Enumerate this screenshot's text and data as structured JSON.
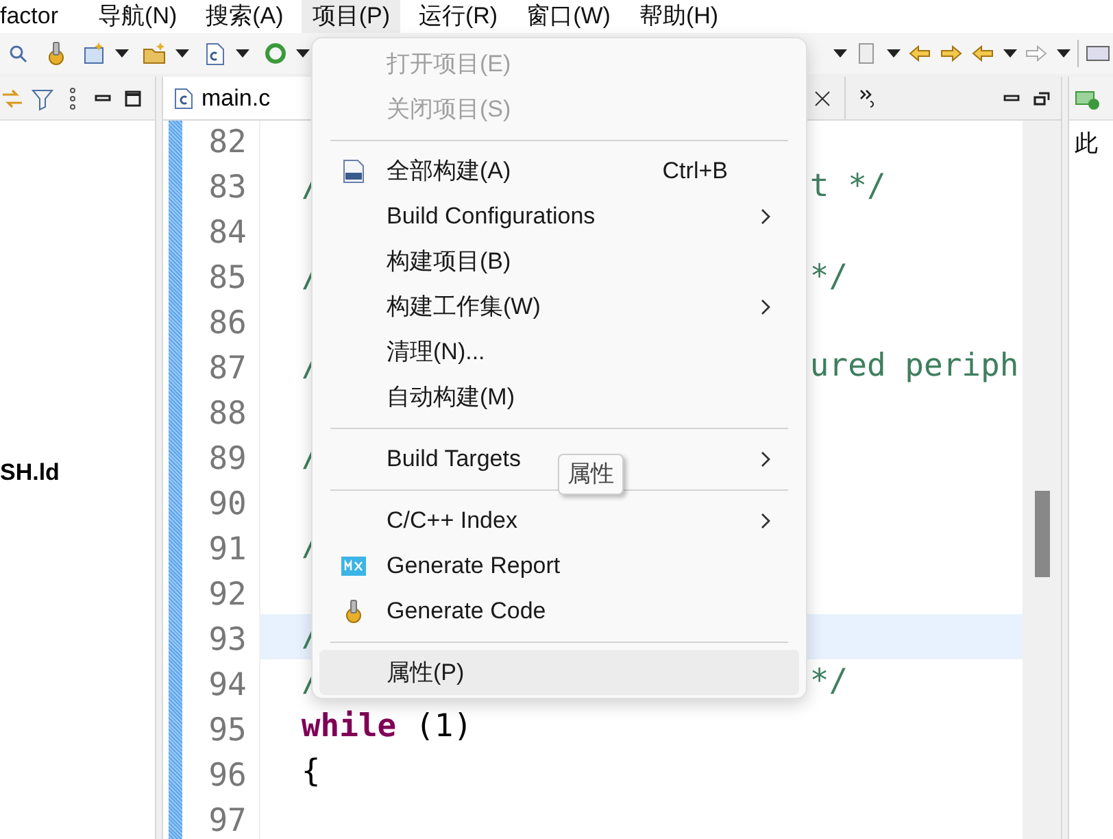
{
  "menubar": [
    {
      "label": "factor",
      "selected": false
    },
    {
      "label": "导航(N)",
      "selected": false
    },
    {
      "label": "搜索(A)",
      "selected": false
    },
    {
      "label": "项目(P)",
      "selected": true
    },
    {
      "label": "运行(R)",
      "selected": false
    },
    {
      "label": "窗口(W)",
      "selected": false
    },
    {
      "label": "帮助(H)",
      "selected": false
    }
  ],
  "left_panel": {
    "items": [
      {
        "label": "SH.ld"
      }
    ]
  },
  "editor": {
    "tab": {
      "label": "main.c"
    },
    "lines": [
      {
        "number": "82",
        "selected": false
      },
      {
        "number": "83",
        "selected": false,
        "tokens": [
          {
            "text": "/",
            "kind": "comment"
          }
        ],
        "right": {
          "text": "t */",
          "kind": "comment"
        }
      },
      {
        "number": "84",
        "selected": false
      },
      {
        "number": "85",
        "selected": false,
        "tokens": [
          {
            "text": "/",
            "kind": "comment"
          }
        ],
        "right": {
          "text": "*/",
          "kind": "comment"
        }
      },
      {
        "number": "86",
        "selected": false
      },
      {
        "number": "87",
        "selected": false,
        "tokens": [
          {
            "text": "/",
            "kind": "comment"
          }
        ],
        "right": {
          "text": "ured periph",
          "kind": "comment"
        }
      },
      {
        "number": "88",
        "selected": false
      },
      {
        "number": "89",
        "selected": false,
        "tokens": [
          {
            "text": "/",
            "kind": "comment"
          }
        ]
      },
      {
        "number": "90",
        "selected": false
      },
      {
        "number": "91",
        "selected": false,
        "tokens": [
          {
            "text": "/",
            "kind": "comment"
          }
        ]
      },
      {
        "number": "92",
        "selected": false
      },
      {
        "number": "93",
        "selected": true,
        "tokens": [
          {
            "text": "/",
            "kind": "comment"
          }
        ]
      },
      {
        "number": "94",
        "selected": false,
        "tokens": [
          {
            "text": "/",
            "kind": "comment"
          }
        ],
        "right": {
          "text": "*/",
          "kind": "comment"
        }
      },
      {
        "number": "95",
        "selected": false,
        "tokens": [
          {
            "text": "while",
            "kind": "keyword"
          },
          {
            "text": " (1)",
            "kind": "plain"
          }
        ]
      },
      {
        "number": "96",
        "selected": false,
        "tokens": [
          {
            "text": "{",
            "kind": "plain"
          }
        ]
      },
      {
        "number": "97",
        "selected": false
      }
    ]
  },
  "context_menu": {
    "items": [
      {
        "kind": "item",
        "label": "打开项目(E)",
        "disabled": true,
        "submenu": false,
        "selected": false
      },
      {
        "kind": "item",
        "label": "关闭项目(S)",
        "disabled": true,
        "submenu": false,
        "selected": false
      },
      {
        "kind": "separator"
      },
      {
        "kind": "item",
        "label": "全部构建(A)",
        "shortcut": "Ctrl+B",
        "disabled": false,
        "submenu": false,
        "selected": false
      },
      {
        "kind": "item",
        "label": "Build Configurations",
        "disabled": false,
        "submenu": true,
        "selected": false
      },
      {
        "kind": "item",
        "label": "构建项目(B)",
        "disabled": false,
        "submenu": false,
        "selected": false
      },
      {
        "kind": "item",
        "label": "构建工作集(W)",
        "disabled": false,
        "submenu": true,
        "selected": false
      },
      {
        "kind": "item",
        "label": "清理(N)...",
        "disabled": false,
        "submenu": false,
        "selected": false
      },
      {
        "kind": "item",
        "label": "自动构建(M)",
        "disabled": false,
        "submenu": false,
        "selected": false
      },
      {
        "kind": "separator"
      },
      {
        "kind": "item",
        "label": "Build Targets",
        "disabled": false,
        "submenu": true,
        "selected": false,
        "tooltip": "属性"
      },
      {
        "kind": "separator"
      },
      {
        "kind": "item",
        "label": "C/C++ Index",
        "disabled": false,
        "submenu": true,
        "selected": false
      },
      {
        "kind": "item",
        "label": "Generate Report",
        "disabled": false,
        "submenu": false,
        "selected": false
      },
      {
        "kind": "item",
        "label": "Generate Code",
        "disabled": false,
        "submenu": false,
        "selected": false
      },
      {
        "kind": "separator"
      },
      {
        "kind": "item",
        "label": "属性(P)",
        "disabled": false,
        "submenu": false,
        "selected": true
      }
    ]
  },
  "right_panel": {
    "text": "此"
  }
}
